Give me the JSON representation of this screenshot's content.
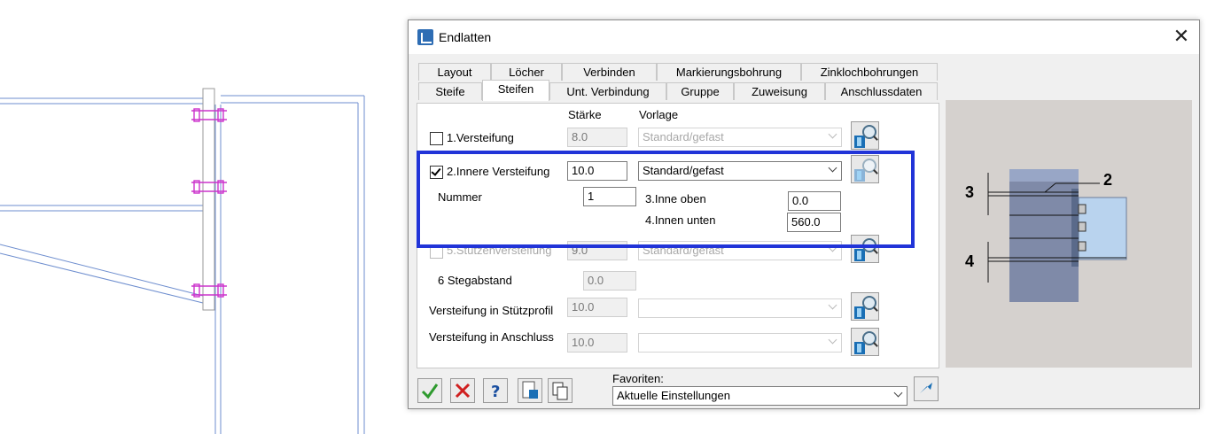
{
  "dialog": {
    "title": "Endlatten",
    "tabs_row1": [
      "Layout",
      "Löcher",
      "Verbinden",
      "Markierungsbohrung",
      "Zinklochbohrungen"
    ],
    "tabs_row2": [
      "Steife",
      "Steifen",
      "Unt. Verbindung",
      "Gruppe",
      "Zuweisung",
      "Anschlussdaten"
    ],
    "active_tab": "Steifen"
  },
  "headers": {
    "staerke": "Stärke",
    "vorlage": "Vorlage"
  },
  "rows": {
    "v1": {
      "label": "1.Versteifung",
      "checked": false,
      "staerke": "8.0",
      "vorlage": "Standard/gefast"
    },
    "v2": {
      "label": "2.Innere Versteifung",
      "checked": true,
      "staerke": "10.0",
      "vorlage": "Standard/gefast"
    },
    "nummer": {
      "label": "Nummer",
      "value": "1"
    },
    "v3": {
      "label": "3.Inne oben",
      "value": "0.0"
    },
    "v4": {
      "label": "4.Innen unten",
      "value": "560.0"
    },
    "v5": {
      "label": "5.Stützenversteifung",
      "checked": false,
      "staerke": "9.0",
      "vorlage": "Standard/gefast"
    },
    "v6": {
      "label": "6 Stegabstand",
      "value": "0.0"
    },
    "stuetz": {
      "label": "Versteifung in Stützprofil",
      "staerke": "10.0",
      "vorlage": ""
    },
    "anschl": {
      "label": "Versteifung in Anschluss",
      "staerke": "10.0",
      "vorlage": ""
    }
  },
  "preview": {
    "labels": [
      "2",
      "3",
      "4"
    ]
  },
  "footer": {
    "favoriten_label": "Favoriten:",
    "favoriten_value": "Aktuelle Einstellungen",
    "buttons": [
      "ok-icon",
      "cancel-icon",
      "help-icon",
      "save-icon",
      "copy-icon"
    ]
  },
  "colors": {
    "highlight": "#2134d8",
    "bolt": "#cc33cc",
    "cad_line": "#6e8ecf"
  }
}
